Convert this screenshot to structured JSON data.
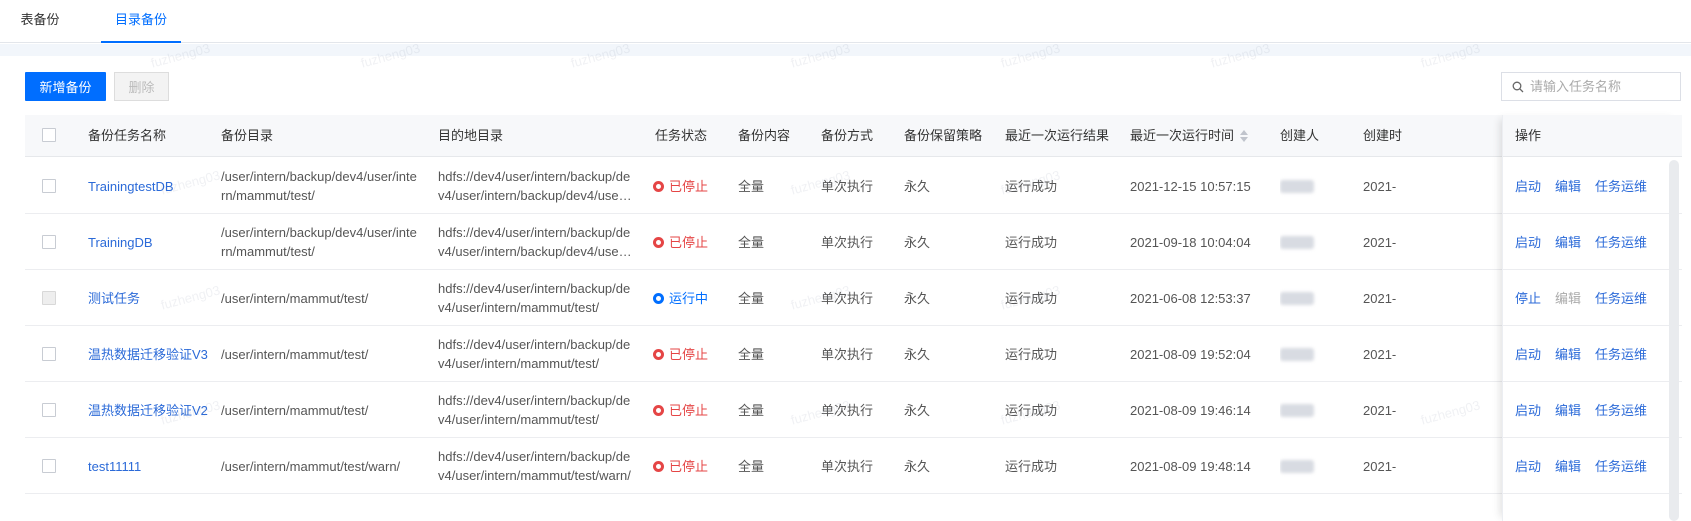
{
  "tabs": [
    {
      "label": "表备份",
      "active": false
    },
    {
      "label": "目录备份",
      "active": true
    }
  ],
  "toolbar": {
    "add_label": "新增备份",
    "delete_label": "删除",
    "search_placeholder": "请输入任务名称"
  },
  "table": {
    "columns": [
      "备份任务名称",
      "备份目录",
      "目的地目录",
      "任务状态",
      "备份内容",
      "备份方式",
      "备份保留策略",
      "最近一次运行结果",
      "最近一次运行时间",
      "创建人",
      "创建时",
      "操作"
    ],
    "rows": [
      {
        "name": "TrainingtestDB",
        "src": "/user/intern/backup/dev4/user/intern/mammut/test/",
        "dest": "hdfs://dev4/user/intern/backup/dev4/user/intern/backup/dev4/user/inter...",
        "status": "已停止",
        "status_type": "stopped",
        "content": "全量",
        "mode": "单次执行",
        "retention": "永久",
        "result": "运行成功",
        "time": "2021-12-15 10:57:15",
        "created": "2021-",
        "op1": "启动",
        "op2": "编辑",
        "op3": "任务运维"
      },
      {
        "name": "TrainingDB",
        "src": "/user/intern/backup/dev4/user/intern/mammut/test/",
        "dest": "hdfs://dev4/user/intern/backup/dev4/user/intern/backup/dev4/user/inter...",
        "status": "已停止",
        "status_type": "stopped",
        "content": "全量",
        "mode": "单次执行",
        "retention": "永久",
        "result": "运行成功",
        "time": "2021-09-18 10:04:04",
        "created": "2021-",
        "op1": "启动",
        "op2": "编辑",
        "op3": "任务运维"
      },
      {
        "name": "测试任务",
        "src": "/user/intern/mammut/test/",
        "dest": "hdfs://dev4/user/intern/backup/dev4/user/intern/mammut/test/",
        "status": "运行中",
        "status_type": "running",
        "content": "全量",
        "mode": "单次执行",
        "retention": "永久",
        "result": "运行成功",
        "time": "2021-06-08 12:53:37",
        "created": "2021-",
        "op1": "停止",
        "op2": "编辑",
        "op3": "任务运维"
      },
      {
        "name": "温热数据迁移验证V3",
        "src": "/user/intern/mammut/test/",
        "dest": "hdfs://dev4/user/intern/backup/dev4/user/intern/mammut/test/",
        "status": "已停止",
        "status_type": "stopped",
        "content": "全量",
        "mode": "单次执行",
        "retention": "永久",
        "result": "运行成功",
        "time": "2021-08-09 19:52:04",
        "created": "2021-",
        "op1": "启动",
        "op2": "编辑",
        "op3": "任务运维"
      },
      {
        "name": "温热数据迁移验证V2",
        "src": "/user/intern/mammut/test/",
        "dest": "hdfs://dev4/user/intern/backup/dev4/user/intern/mammut/test/",
        "status": "已停止",
        "status_type": "stopped",
        "content": "全量",
        "mode": "单次执行",
        "retention": "永久",
        "result": "运行成功",
        "time": "2021-08-09 19:46:14",
        "created": "2021-",
        "op1": "启动",
        "op2": "编辑",
        "op3": "任务运维"
      },
      {
        "name": "test11111",
        "src": "/user/intern/mammut/test/warn/",
        "dest": "hdfs://dev4/user/intern/backup/dev4/user/intern/mammut/test/warn/",
        "status": "已停止",
        "status_type": "stopped",
        "content": "全量",
        "mode": "单次执行",
        "retention": "永久",
        "result": "运行成功",
        "time": "2021-08-09 19:48:14",
        "created": "2021-",
        "op1": "启动",
        "op2": "编辑",
        "op3": "任务运维"
      }
    ]
  },
  "watermark_text": "fuzheng03",
  "colors": {
    "primary": "#006eff",
    "stopped": "#e54545",
    "link": "#2b6ad8"
  },
  "icons": {
    "search": "search-icon",
    "sort": "sort-icon",
    "checkbox": "checkbox"
  }
}
